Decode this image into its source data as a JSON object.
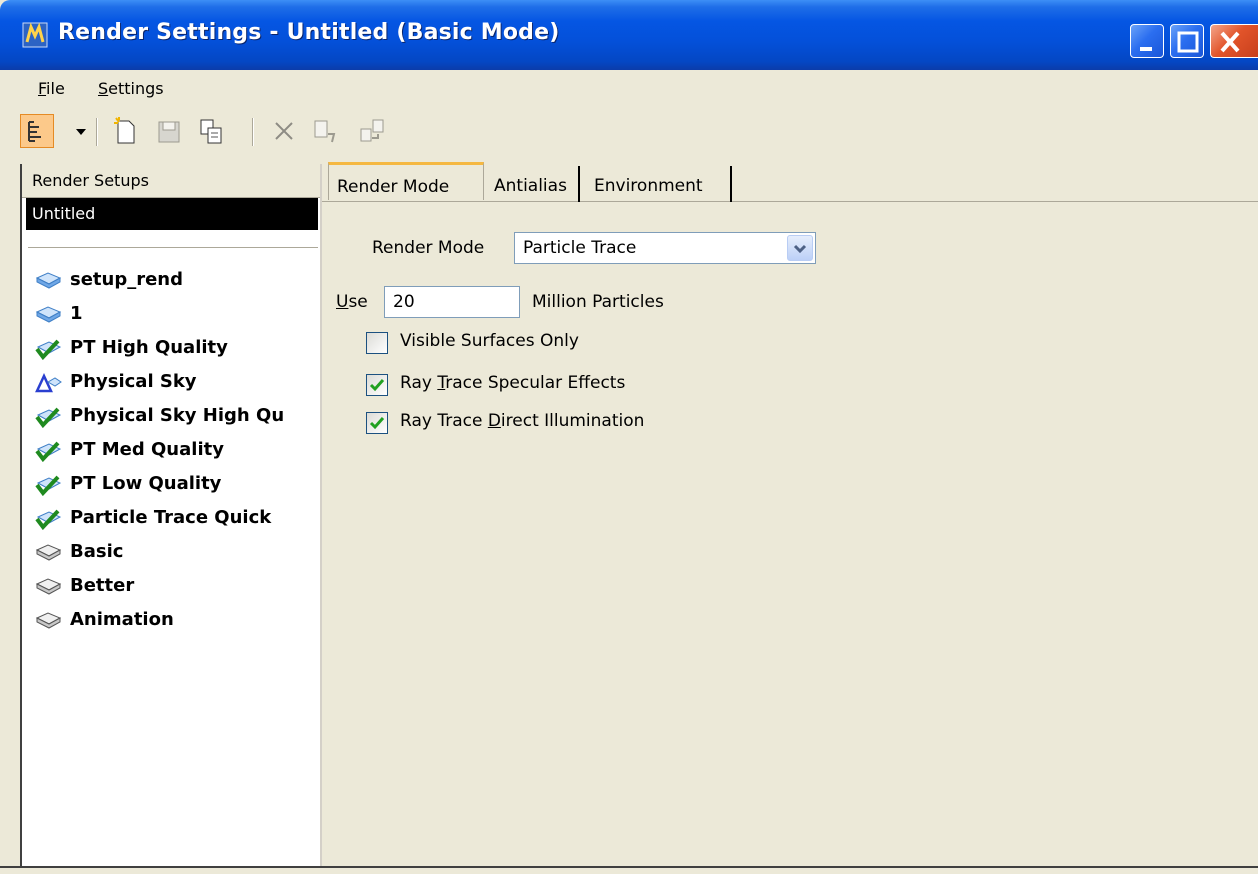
{
  "window": {
    "title": "Render Settings - Untitled (Basic Mode)",
    "icon": "app-logo-icon"
  },
  "menu": {
    "file": {
      "prefix": "F",
      "rest": "ile"
    },
    "settings": {
      "prefix": "S",
      "rest": "ettings"
    }
  },
  "toolbar": {
    "icons": [
      "tree-view-icon",
      "dropdown-arrow-icon",
      "new-icon",
      "save-icon",
      "copy-icon",
      "delete-icon",
      "rename-icon",
      "import-icon"
    ]
  },
  "sidebar": {
    "header": "Render Setups",
    "selected": "Untitled",
    "items": [
      {
        "label": "setup_rend",
        "icon": "render-setup-blue-icon"
      },
      {
        "label": "1",
        "icon": "render-setup-blue-icon"
      },
      {
        "label": "PT High Quality",
        "icon": "checked-setup-icon"
      },
      {
        "label": "Physical Sky",
        "icon": "physical-sky-icon"
      },
      {
        "label": "Physical Sky High Qu",
        "icon": "checked-setup-icon"
      },
      {
        "label": "PT Med Quality",
        "icon": "checked-setup-icon"
      },
      {
        "label": "PT Low Quality",
        "icon": "checked-setup-icon"
      },
      {
        "label": "Particle Trace Quick",
        "icon": "checked-setup-icon"
      },
      {
        "label": "Basic",
        "icon": "render-setup-gray-icon"
      },
      {
        "label": "Better",
        "icon": "render-setup-gray-icon"
      },
      {
        "label": "Animation",
        "icon": "render-setup-gray-icon"
      }
    ]
  },
  "tabs": [
    "Render Mode",
    "Antialias",
    "Environment"
  ],
  "render_mode": {
    "label": "Render Mode",
    "value": "Particle Trace"
  },
  "particles": {
    "use_prefix": "U",
    "use_rest": "se",
    "value": "20",
    "suffix": "Million Particles"
  },
  "options": [
    {
      "pre": "Visible Surfaces Only",
      "ul": "",
      "post": "",
      "checked": false
    },
    {
      "pre": "Ray ",
      "ul": "T",
      "post": "race Specular Effects",
      "checked": true
    },
    {
      "pre": "Ray Trace ",
      "ul": "D",
      "post": "irect Illumination",
      "checked": true
    }
  ],
  "colors": {
    "titlebar": "#0450d9",
    "selection": "#000000",
    "active_tab_accent": "#f5b841"
  }
}
